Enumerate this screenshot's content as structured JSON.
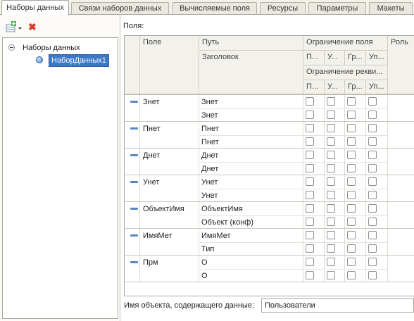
{
  "tabs": [
    {
      "label": "Наборы данных",
      "active": true
    },
    {
      "label": "Связи наборов данных",
      "active": false
    },
    {
      "label": "Вычисляемые поля",
      "active": false
    },
    {
      "label": "Ресурсы",
      "active": false
    },
    {
      "label": "Параметры",
      "active": false
    },
    {
      "label": "Макеты",
      "active": false
    }
  ],
  "toolbar": {
    "add_icon": "add-dataset-icon",
    "delete_icon": "delete-icon",
    "delete_glyph": "✖",
    "dropdown_glyph": "▾"
  },
  "tree": {
    "root_label": "Наборы данных",
    "child_label": "НаборДанных1"
  },
  "fields_label": "Поля:",
  "headers": {
    "field": "Поле",
    "path": "Путь",
    "title": "Заголовок",
    "field_restriction": "Ограничение поля",
    "requisite_restriction": "Ограничение рекви...",
    "r1": [
      "П...",
      "У...",
      "Гр...",
      "Уп..."
    ],
    "r2": [
      "П...",
      "У...",
      "Гр...",
      "Уп..."
    ],
    "role": "Роль"
  },
  "rows": [
    {
      "field": "Знет",
      "path": "Знет",
      "title": "Знет"
    },
    {
      "field": "Пнет",
      "path": "Пнет",
      "title": "Пнет"
    },
    {
      "field": "Днет",
      "path": "Днет",
      "title": "Днет"
    },
    {
      "field": "Унет",
      "path": "Унет",
      "title": "Унет"
    },
    {
      "field": "ОбъектИмя",
      "path": "ОбъектИмя",
      "title": "Объект (конф)"
    },
    {
      "field": "ИмяМет",
      "path": "ИмяМет",
      "title": "Тип"
    },
    {
      "field": "Прм",
      "path": "О",
      "title": "О"
    }
  ],
  "footer": {
    "label": "Имя объекта, содержащего данные:",
    "value": "Пользователи"
  }
}
